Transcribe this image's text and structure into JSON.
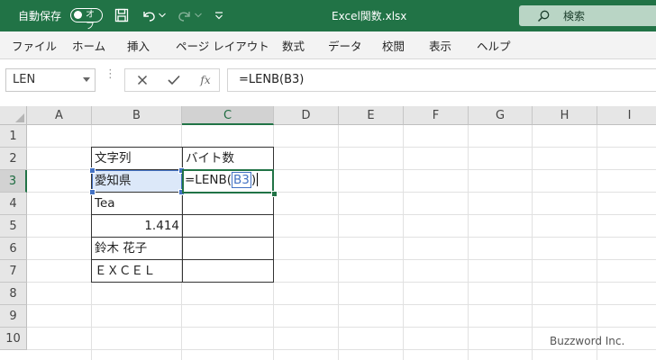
{
  "titlebar": {
    "autosave_label": "自動保存",
    "autosave_state": "オフ",
    "filename": "Excel関数.xlsx",
    "search_placeholder": "検索",
    "accent_color": "#217346"
  },
  "ribbon": {
    "tabs": [
      "ファイル",
      "ホーム",
      "挿入",
      "ページ レイアウト",
      "数式",
      "データ",
      "校閲",
      "表示",
      "ヘルプ"
    ]
  },
  "formula_bar": {
    "name_box": "LEN",
    "function_symbol": "fx",
    "formula": "=LENB(B3)"
  },
  "columns": [
    "A",
    "B",
    "C",
    "D",
    "E",
    "F",
    "G",
    "H",
    "I"
  ],
  "rows": [
    "1",
    "2",
    "3",
    "4",
    "5",
    "6",
    "7",
    "8",
    "9",
    "10"
  ],
  "cells": {
    "B2": "文字列",
    "C2": "バイト数",
    "B3": "愛知県",
    "C3_edit": {
      "prefix": "=LENB(",
      "ref": "B3",
      "suffix": ")"
    },
    "B4": "Tea",
    "B5": "1.414",
    "B6": "鈴木 花子",
    "B7": "ＥＸＣＥＬ"
  },
  "selection": {
    "active_cell": "C3",
    "referenced_cell": "B3",
    "ref_color": "#4472c4"
  },
  "watermark": "Buzzword Inc."
}
